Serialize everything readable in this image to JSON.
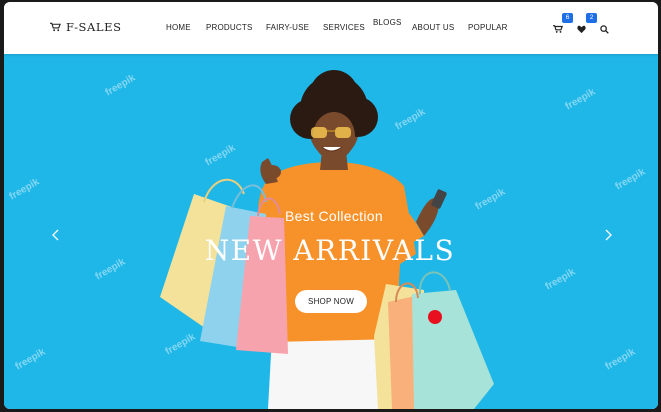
{
  "brand": {
    "name": "F-SALES",
    "icon": "cart-icon"
  },
  "nav": {
    "items": [
      {
        "label": "HOME"
      },
      {
        "label": "PRODUCTS"
      },
      {
        "label": "FAIRY-USE"
      },
      {
        "label": "SERVICES"
      },
      {
        "label": "BLOGS"
      },
      {
        "label": "ABOUT US"
      },
      {
        "label": "POPULAR"
      }
    ]
  },
  "actions": {
    "cart": {
      "icon": "cart-icon",
      "count": "6"
    },
    "wishlist": {
      "icon": "heart-icon",
      "count": "2"
    },
    "search": {
      "icon": "search-icon"
    }
  },
  "hero": {
    "subtitle": "Best Collection",
    "title": "NEW ARRIVALS",
    "cta": "SHOP NOW",
    "watermark": "freepik",
    "prev_icon": "chevron-left-icon",
    "next_icon": "chevron-right-icon"
  },
  "colors": {
    "accent": "#1e6fe6",
    "hero_bg": "#1fb7e8",
    "sweater": "#f7922a",
    "marker": "#e8101e"
  }
}
